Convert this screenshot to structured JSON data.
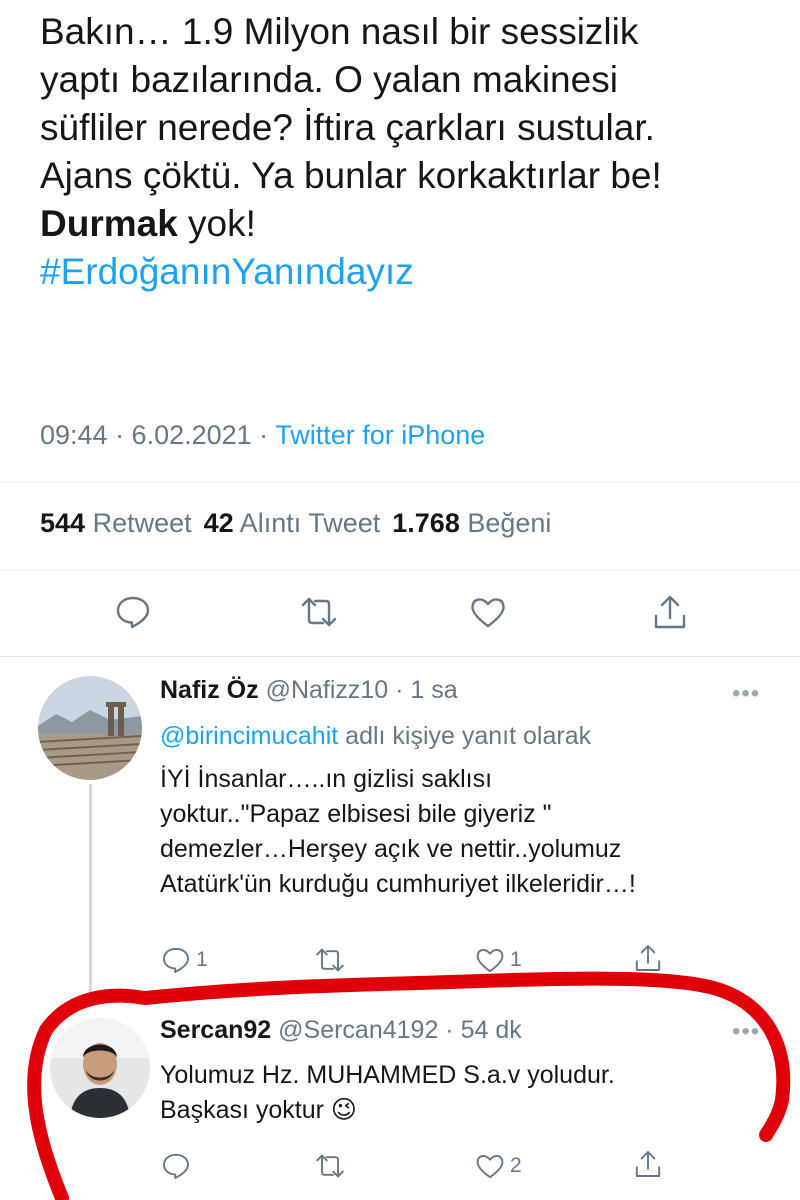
{
  "main_tweet": {
    "lines": [
      "Bakın… 1.9 Milyon nasıl bir sessizlik",
      "yaptı bazılarında. O yalan makinesi",
      "süfliler nerede? İftira çarkları sustular.",
      "Ajans çöktü. Ya bunlar korkaktırlar be!"
    ],
    "bold_word": "Durmak",
    "after_bold": " yok!",
    "hashtag": "#ErdoğanınYanındayız",
    "time_date": "09:44 · 6.02.2021 · ",
    "source": "Twitter for iPhone",
    "stats": {
      "retweets": "544",
      "retweets_label": " Retweet",
      "quotes": "42",
      "quotes_label": " Alıntı Tweet",
      "likes": "1.768",
      "likes_label": " Beğeni"
    }
  },
  "replies": [
    {
      "name": "Nafiz Öz",
      "handle_time": " @Nafizz10 · 1 sa",
      "reply_to_mention": "@birincimucahit",
      "reply_to_suffix": " adlı kişiye yanıt olarak",
      "lines": [
        "İYİ İnsanlar…..ın gizlisi saklısı",
        "yoktur..\"Papaz elbisesi bile giyeriz \"",
        "demezler…Herşey açık ve nettir..yolumuz",
        "Atatürk'ün kurduğu cumhuriyet ilkeleridir…!"
      ],
      "reply_count": "1",
      "retweet_count": "",
      "like_count": "1"
    },
    {
      "name": "Sercan92",
      "handle_time": " @Sercan4192 · 54 dk",
      "lines": [
        "Yolumuz Hz. MUHAMMED S.a.v yoludur.",
        "Başkası yoktur"
      ],
      "emoji": "😉",
      "reply_count": "",
      "retweet_count": "",
      "like_count": "2"
    }
  ],
  "more_label": "•••",
  "icons": {
    "reply": "reply-bubble-icon",
    "retweet": "retweet-icon",
    "like": "heart-icon",
    "share": "share-icon"
  },
  "colors": {
    "link": "#1da1f2",
    "secondary": "#657786",
    "annotation": "#e0000a"
  }
}
